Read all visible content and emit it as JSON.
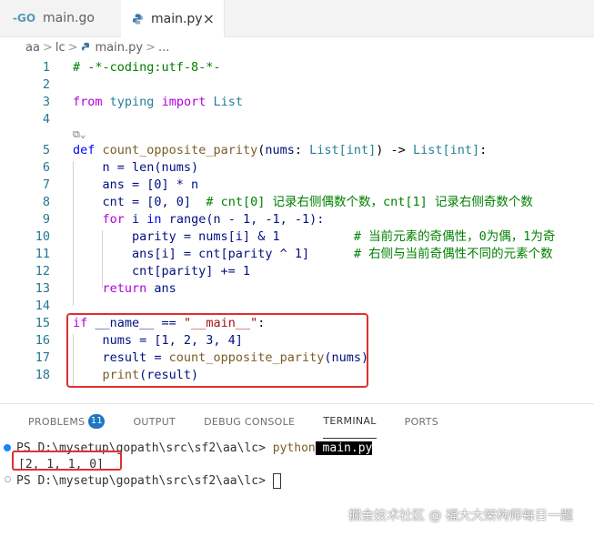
{
  "tabs": [
    {
      "icon": "go-file-icon",
      "glyph": "-GO",
      "label": "main.go",
      "active": false
    },
    {
      "icon": "python-file-icon",
      "label": "main.py",
      "active": true,
      "close": "×"
    }
  ],
  "breadcrumb": [
    "aa",
    "lc",
    "main.py",
    "..."
  ],
  "editor": {
    "lines": [
      {
        "n": "1"
      },
      {
        "n": "2"
      },
      {
        "n": "3"
      },
      {
        "n": "4"
      },
      {
        "n": "5"
      },
      {
        "n": "6"
      },
      {
        "n": "7"
      },
      {
        "n": "8"
      },
      {
        "n": "9"
      },
      {
        "n": "10"
      },
      {
        "n": "11"
      },
      {
        "n": "12"
      },
      {
        "n": "13"
      },
      {
        "n": "14"
      },
      {
        "n": "15"
      },
      {
        "n": "16"
      },
      {
        "n": "17"
      },
      {
        "n": "18"
      }
    ],
    "code": {
      "l1": "# -*-coding:utf-8-*-",
      "l3_from": "from",
      "l3_mod": "typing",
      "l3_import": "import",
      "l3_name": "List",
      "l5_def": "def",
      "l5_fn": "count_opposite_parity",
      "l5_p1": "(",
      "l5_nums": "nums",
      "l5_c1": ": ",
      "l5_List": "List",
      "l5_int": "[int]",
      "l5_arrow": ") -> ",
      "l5_List2": "List",
      "l5_int2": "[int]",
      "l5_end": ":",
      "l6": "    n = len(nums)",
      "l7": "    ans = [0] * n",
      "l8_code": "    cnt = [0, 0]  ",
      "l8_cm": "# cnt[0] 记录右侧偶数个数，cnt[1] 记录右侧奇数个数",
      "l9_for": "for",
      "l9_i": " i ",
      "l9_in": "in",
      "l9_rest": " range(n - 1, -1, -1):",
      "l10_code": "        parity = nums[i] & 1          ",
      "l10_cm": "# 当前元素的奇偶性，0为偶，1为奇",
      "l11_code": "        ans[i] = cnt[parity ^ 1]      ",
      "l11_cm": "# 右侧与当前奇偶性不同的元素个数",
      "l12": "        cnt[parity] += 1",
      "l13_ret": "return",
      "l13_rest": " ans",
      "l15_if": "if",
      "l15_name": " __name__ == ",
      "l15_str": "\"__main__\"",
      "l15_end": ":",
      "l16": "    nums = [1, 2, 3, 4]",
      "l17_a": "    result = ",
      "l17_fn": "count_opposite_parity",
      "l17_b": "(nums)",
      "l18_fn": "print",
      "l18_b": "(result)"
    },
    "codelens_hint": "⧉⌄"
  },
  "panel": {
    "tabs": [
      "PROBLEMS",
      "OUTPUT",
      "DEBUG CONSOLE",
      "TERMINAL",
      "PORTS"
    ],
    "problems_count": "11",
    "active_tab": "TERMINAL"
  },
  "terminal": {
    "prompt1": "PS D:\\mysetup\\gopath\\src\\sf2\\aa\\lc> ",
    "cmd": "python",
    "arg": " main.py",
    "output": "[2, 1, 1, 0]",
    "prompt2": "PS D:\\mysetup\\gopath\\src\\sf2\\aa\\lc> "
  },
  "watermark": "掘金技术社区 @ 福大大架构师每日一题",
  "colors": {
    "accent_red_box": "#e03030",
    "badge_blue": "#1f76c5",
    "line_number": "#237893"
  }
}
